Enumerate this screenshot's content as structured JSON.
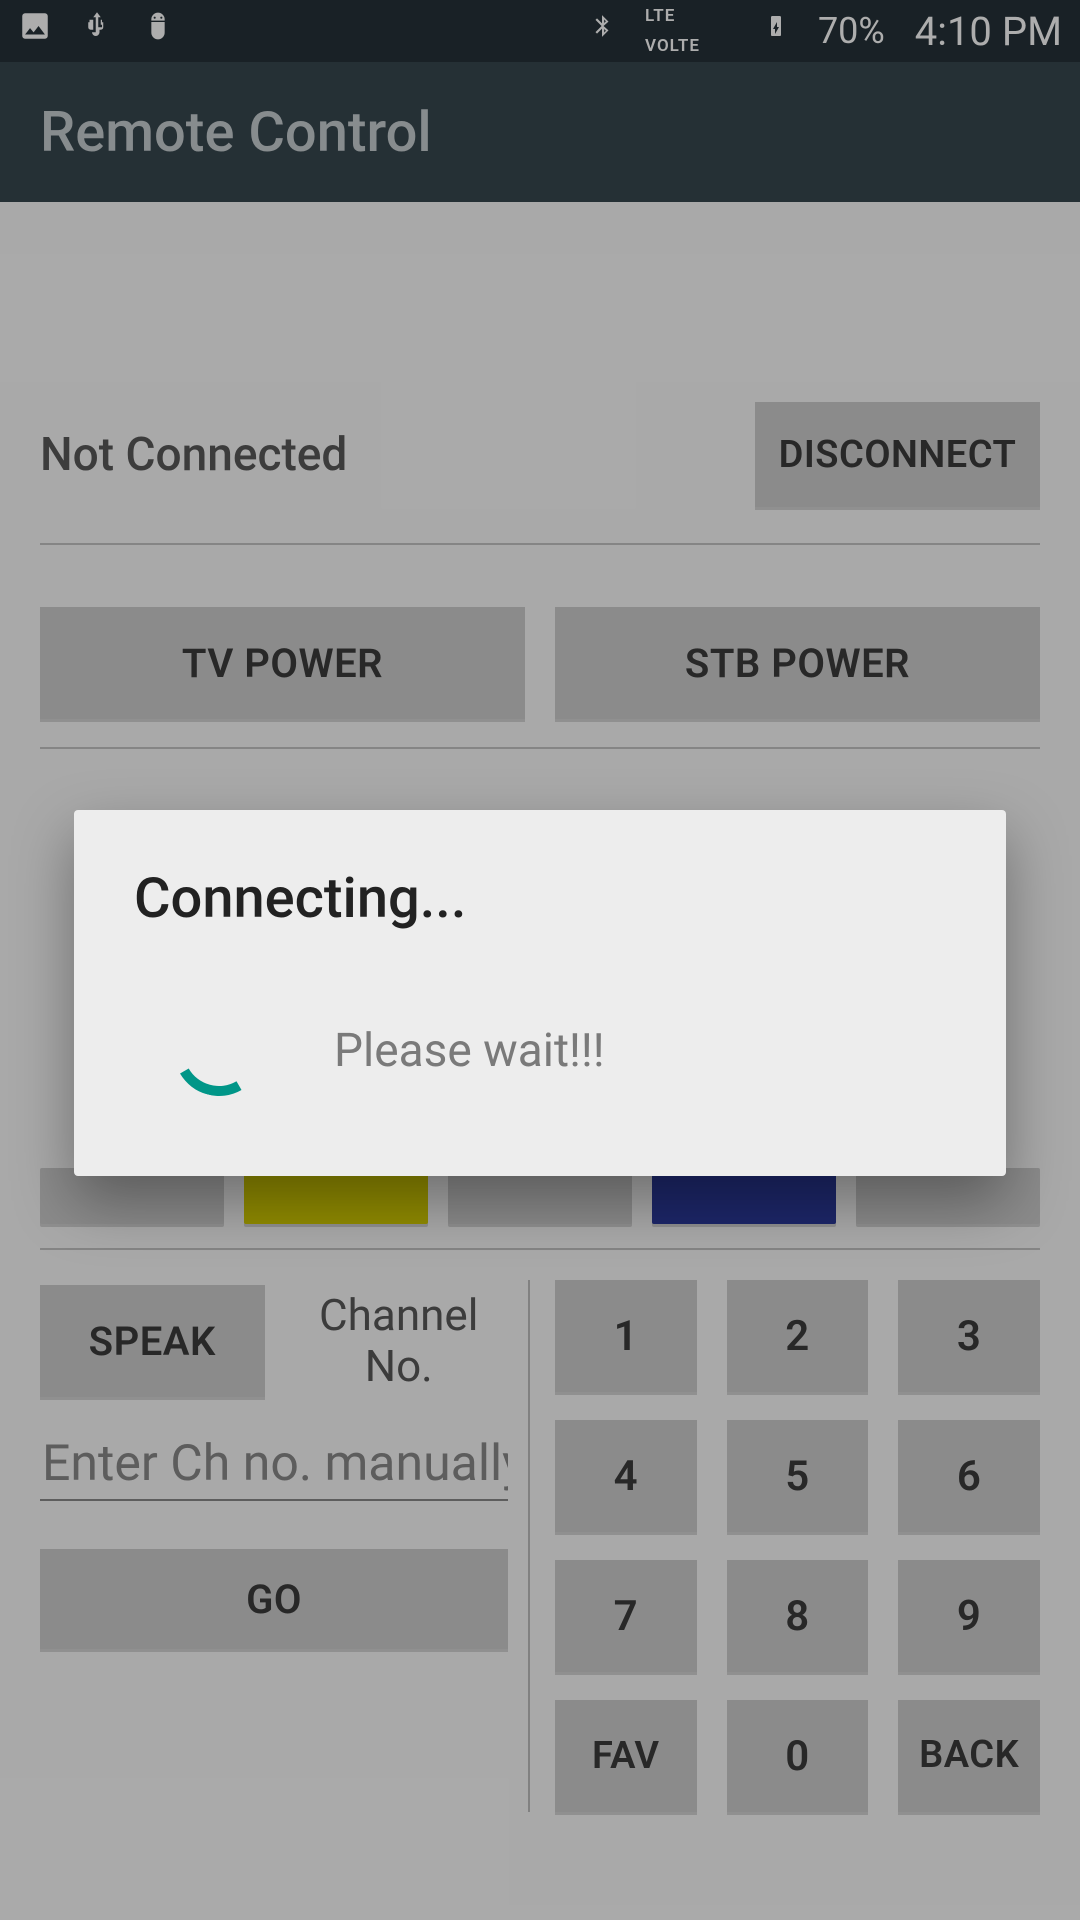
{
  "status_bar": {
    "battery_pct": "70%",
    "clock": "4:10 PM"
  },
  "app_bar": {
    "title": "Remote Control"
  },
  "connection": {
    "status_text": "Not Connected",
    "disconnect_label": "DISCONNECT"
  },
  "power": {
    "tv_label": "TV POWER",
    "stb_label": "STB POWER"
  },
  "channel_panel": {
    "speak_label": "SPEAK",
    "channel_label": "Channel No.",
    "input_placeholder": "Enter Ch no. manually",
    "go_label": "GO"
  },
  "keypad": {
    "k1": "1",
    "k2": "2",
    "k3": "3",
    "k4": "4",
    "k5": "5",
    "k6": "6",
    "k7": "7",
    "k8": "8",
    "k9": "9",
    "fav": "FAV",
    "k0": "0",
    "back": "BACK"
  },
  "dialog": {
    "title": "Connecting...",
    "message": "Please wait!!!"
  }
}
